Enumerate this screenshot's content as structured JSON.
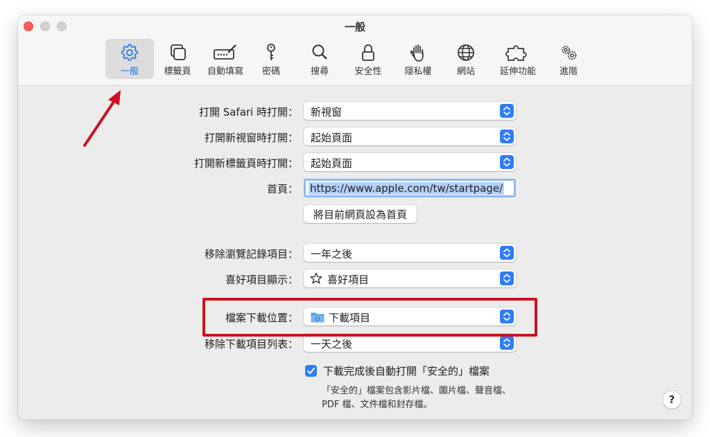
{
  "window": {
    "title": "一般"
  },
  "toolbar": {
    "tabs": [
      {
        "label": "一般",
        "icon": "gear-icon",
        "active": true
      },
      {
        "label": "標籤頁",
        "icon": "tabs-icon"
      },
      {
        "label": "自動填寫",
        "icon": "autofill-pen-icon"
      },
      {
        "label": "密碼",
        "icon": "key-icon"
      },
      {
        "label": "搜尋",
        "icon": "magnifier-icon"
      },
      {
        "label": "安全性",
        "icon": "lock-icon"
      },
      {
        "label": "隱私權",
        "icon": "hand-icon"
      },
      {
        "label": "網站",
        "icon": "globe-icon"
      },
      {
        "label": "延伸功能",
        "icon": "puzzle-icon"
      },
      {
        "label": "進階",
        "icon": "gears-icon"
      }
    ]
  },
  "settings": {
    "safari_opens_with": {
      "label": "打開 Safari 時打開：",
      "value": "新視窗"
    },
    "new_windows_open_with": {
      "label": "打開新視窗時打開：",
      "value": "起始頁面"
    },
    "new_tabs_open_with": {
      "label": "打開新標籤頁時打開：",
      "value": "起始頁面"
    },
    "homepage": {
      "label": "首頁：",
      "value": "https://www.apple.com/tw/startpage/"
    },
    "set_current_page_button": "將目前網頁設為首頁",
    "remove_history": {
      "label": "移除瀏覽記錄項目：",
      "value": "一年之後"
    },
    "favorites_shows": {
      "label": "喜好項目顯示：",
      "value": "喜好項目"
    },
    "download_location": {
      "label": "檔案下載位置：",
      "value": "下載項目"
    },
    "remove_download_list": {
      "label": "移除下載項目列表：",
      "value": "一天之後"
    },
    "open_safe_files": {
      "label": "下載完成後自動打開「安全的」檔案",
      "checked": true
    },
    "safe_files_note_line1": "「安全的」檔案包含影片檔、圖片檔、聲音檔、",
    "safe_files_note_line2": "PDF 檔、文件檔和封存檔。"
  },
  "help_button": "?",
  "colors": {
    "accent": "#2f7cf6",
    "annotation_red": "#cc1020",
    "active_tab_label": "#1a73e8"
  }
}
